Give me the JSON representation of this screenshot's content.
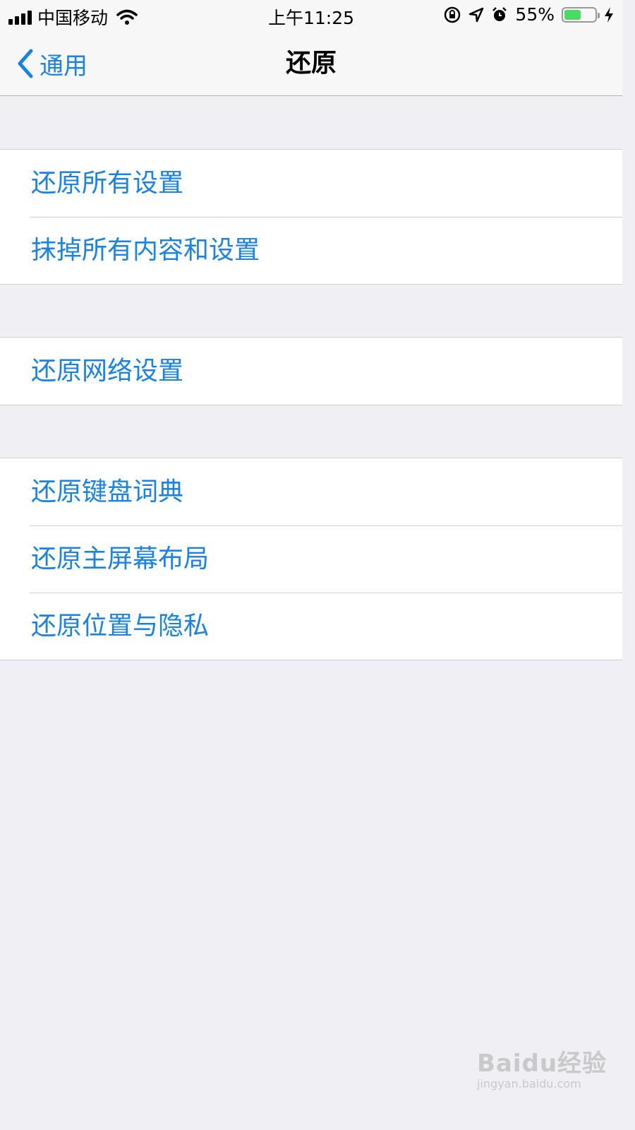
{
  "status_bar": {
    "carrier": "中国移动",
    "time": "上午11:25",
    "battery_percent": "55%",
    "battery_level": 0.55,
    "icons": [
      "signal-bars-icon",
      "wifi-icon",
      "orientation-lock-icon",
      "location-icon",
      "alarm-icon",
      "battery-icon",
      "charging-bolt-icon"
    ]
  },
  "nav": {
    "back_label": "通用",
    "title": "还原"
  },
  "groups": [
    {
      "items": [
        {
          "label": "还原所有设置"
        },
        {
          "label": "抹掉所有内容和设置"
        }
      ]
    },
    {
      "items": [
        {
          "label": "还原网络设置"
        }
      ]
    },
    {
      "items": [
        {
          "label": "还原键盘词典"
        },
        {
          "label": "还原主屏幕布局"
        },
        {
          "label": "还原位置与隐私"
        }
      ]
    }
  ],
  "watermark": {
    "main": "Baidu经验",
    "sub": "jingyan.baidu.com"
  },
  "colors": {
    "accent": "#1a82e2",
    "background": "#efeff4",
    "battery": "#4cd964"
  }
}
